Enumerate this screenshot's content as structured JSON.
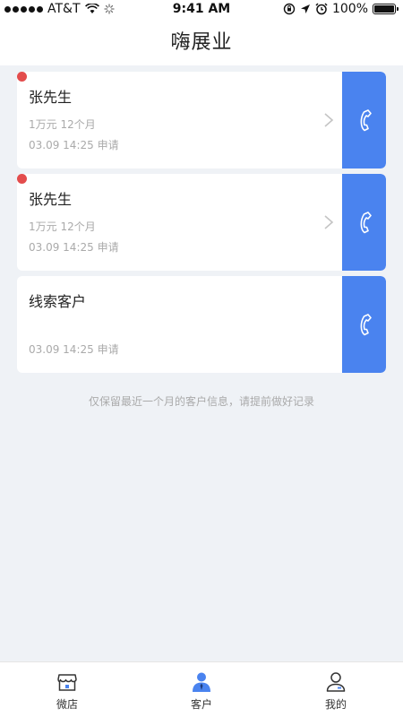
{
  "status_bar": {
    "carrier": "AT&T",
    "time": "9:41 AM",
    "battery": "100%"
  },
  "header": {
    "title": "嗨展业"
  },
  "customers": [
    {
      "name": "张先生",
      "detail": "1万元 12个月",
      "time": "03.09  14:25 申请",
      "unread": true
    },
    {
      "name": "张先生",
      "detail": "1万元 12个月",
      "time": "03.09  14:25 申请",
      "unread": true
    },
    {
      "name": "线索客户",
      "detail": "",
      "time": "03.09  14:25 申请",
      "unread": false
    }
  ],
  "footnote": "仅保留最近一个月的客户信息，请提前做好记录",
  "tabs": [
    {
      "label": "微店",
      "icon": "shop-icon",
      "active": false
    },
    {
      "label": "客户",
      "icon": "customer-icon",
      "active": true
    },
    {
      "label": "我的",
      "icon": "profile-icon",
      "active": false
    }
  ],
  "colors": {
    "accent": "#4a83ef",
    "unread_dot": "#e34c4c",
    "background": "#eff2f6"
  }
}
